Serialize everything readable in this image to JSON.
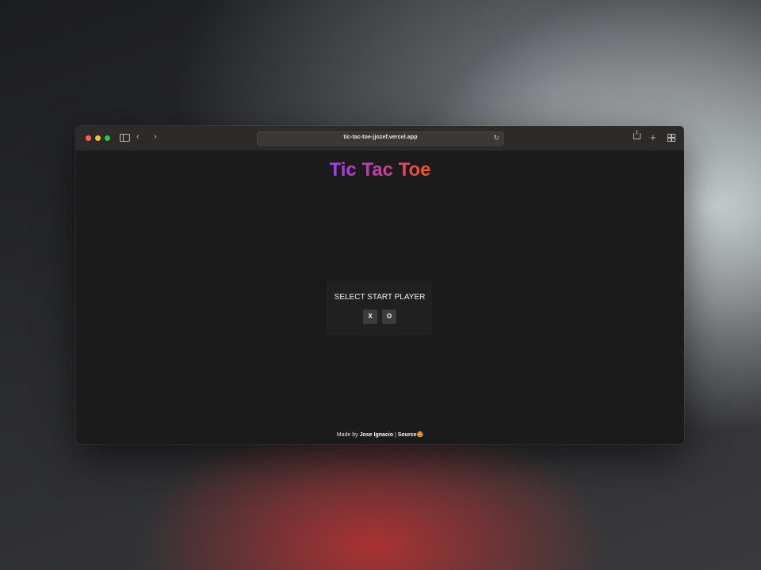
{
  "browser": {
    "url": "tic-tac-toe-jjozef.vercel.app"
  },
  "page": {
    "title": "Tic Tac Toe",
    "start_panel": {
      "label": "SELECT START PLAYER",
      "options": [
        "X",
        "O"
      ]
    },
    "footer": {
      "made_by_prefix": "Made by",
      "author": "Jose Ignacio",
      "separator": "|",
      "source": "Source",
      "emoji": "🤩"
    }
  },
  "colors": {
    "title_gradient": [
      "#a438ff",
      "#c8409a",
      "#f0561a"
    ],
    "page_background": "#1b1b1b",
    "button_background": "#3c3c3c"
  },
  "icons": [
    "sidebar-icon",
    "back-icon",
    "forward-icon",
    "reload-icon",
    "share-icon",
    "plus-icon",
    "tab-overview-icon"
  ]
}
